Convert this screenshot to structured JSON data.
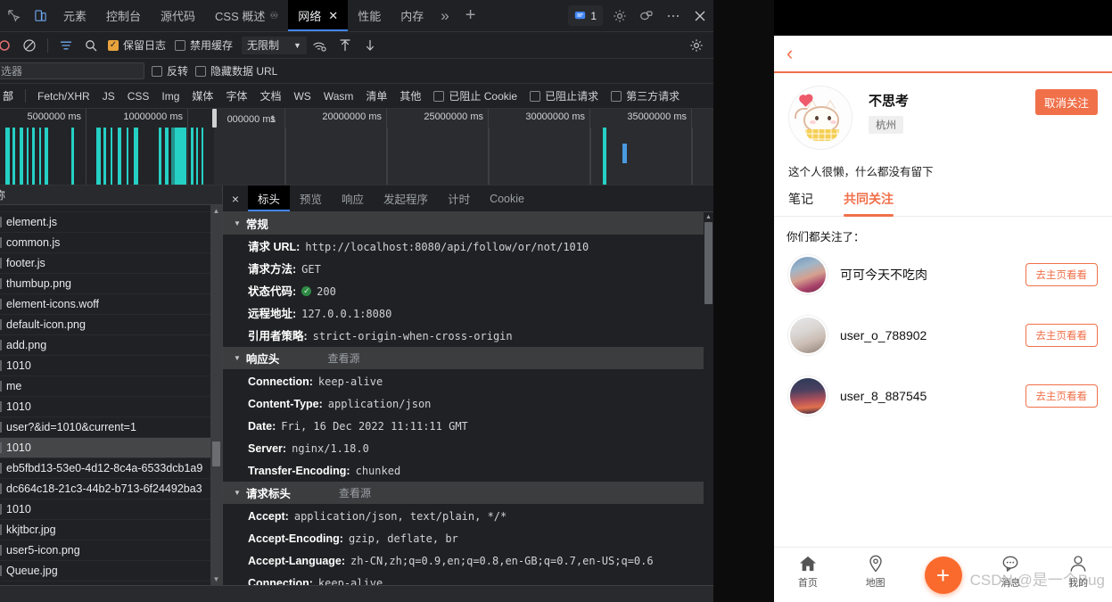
{
  "devtools": {
    "tabs": [
      {
        "label": "元素",
        "selected": false
      },
      {
        "label": "控制台",
        "selected": false
      },
      {
        "label": "源代码",
        "selected": false
      },
      {
        "label": "CSS 概述",
        "selected": false,
        "warn": true
      },
      {
        "label": "网络",
        "selected": true,
        "closable": true
      },
      {
        "label": "性能",
        "selected": false
      },
      {
        "label": "内存",
        "selected": false
      }
    ],
    "overflow_label": "»",
    "add_label": "+",
    "issues_count": "1",
    "icons": {
      "inspect": "inspect-icon",
      "device": "device-toolbar-icon",
      "settings": "gear-icon",
      "feedback": "feedback-icon",
      "more": "more-options-icon",
      "close": "close-icon"
    },
    "toolbar": {
      "record_title": "record-button",
      "clear_title": "clear-button",
      "filter_title": "filter-button",
      "search_title": "search-button",
      "preserve_log": {
        "label": "保留日志",
        "checked": true
      },
      "disable_cache": {
        "label": "禁用缓存",
        "checked": false
      },
      "throttle": {
        "value": "无限制",
        "caret": "▼"
      },
      "wifi_title": "network-conditions-icon",
      "import_title": "import-har-icon",
      "export_title": "export-har-icon",
      "settings_title": "network-settings-gear-icon"
    },
    "filter_row": {
      "input_placeholder": "选器",
      "invert": {
        "label": "反转",
        "checked": false
      },
      "hide_data_urls": {
        "label": "隐藏数据 URL",
        "checked": false
      }
    },
    "type_row": {
      "items": [
        "部",
        "Fetch/XHR",
        "JS",
        "CSS",
        "Img",
        "媒体",
        "字体",
        "文档",
        "WS",
        "Wasm",
        "清单",
        "其他"
      ],
      "selected_index": 0,
      "checks": [
        {
          "label": "已阻止 Cookie",
          "checked": false
        },
        {
          "label": "已阻止请求",
          "checked": false
        },
        {
          "label": "第三方请求",
          "checked": false
        }
      ]
    },
    "overview": {
      "ticks": [
        "5000000 ms",
        "10000000 ms",
        "000000 ms",
        "20000000 ms",
        "25000000 ms",
        "30000000 ms",
        "35000000 ms"
      ],
      "partial_tick_prefix": "1"
    },
    "requests": {
      "column_header": "称",
      "rows": [
        {
          "name": "element.js",
          "selected": false
        },
        {
          "name": "common.js",
          "selected": false
        },
        {
          "name": "footer.js",
          "selected": false
        },
        {
          "name": "thumbup.png",
          "selected": false
        },
        {
          "name": "element-icons.woff",
          "selected": false
        },
        {
          "name": "default-icon.png",
          "selected": false
        },
        {
          "name": "add.png",
          "selected": false
        },
        {
          "name": "1010",
          "selected": false
        },
        {
          "name": "me",
          "selected": false
        },
        {
          "name": "1010",
          "selected": false
        },
        {
          "name": "user?&id=1010&current=1",
          "selected": false
        },
        {
          "name": "1010",
          "selected": true
        },
        {
          "name": "eb5fbd13-53e0-4d12-8c4a-6533dcb1a9",
          "selected": false
        },
        {
          "name": "dc664c18-21c3-44b2-b713-6f24492ba3",
          "selected": false
        },
        {
          "name": "1010",
          "selected": false
        },
        {
          "name": "kkjtbcr.jpg",
          "selected": false
        },
        {
          "name": "user5-icon.png",
          "selected": false
        },
        {
          "name": "Queue.jpg",
          "selected": false
        }
      ]
    },
    "detail": {
      "close_label": "×",
      "tabs": [
        {
          "label": "标头",
          "selected": true
        },
        {
          "label": "预览",
          "selected": false
        },
        {
          "label": "响应",
          "selected": false
        },
        {
          "label": "发起程序",
          "selected": false
        },
        {
          "label": "计时",
          "selected": false
        },
        {
          "label": "Cookie",
          "selected": false
        }
      ],
      "view_source_label": "查看源",
      "sections": [
        {
          "title": "常规",
          "has_source_link": false,
          "rows": [
            {
              "key": "请求 URL:",
              "value": "http://localhost:8080/api/follow/or/not/1010"
            },
            {
              "key": "请求方法:",
              "value": "GET"
            },
            {
              "key": "状态代码:",
              "value": "200",
              "status_ok": true
            },
            {
              "key": "远程地址:",
              "value": "127.0.0.1:8080"
            },
            {
              "key": "引用者策略:",
              "value": "strict-origin-when-cross-origin"
            }
          ]
        },
        {
          "title": "响应头",
          "has_source_link": true,
          "rows": [
            {
              "key": "Connection:",
              "value": "keep-alive"
            },
            {
              "key": "Content-Type:",
              "value": "application/json"
            },
            {
              "key": "Date:",
              "value": "Fri, 16 Dec 2022 11:11:11 GMT"
            },
            {
              "key": "Server:",
              "value": "nginx/1.18.0"
            },
            {
              "key": "Transfer-Encoding:",
              "value": "chunked"
            }
          ]
        },
        {
          "title": "请求标头",
          "has_source_link": true,
          "rows": [
            {
              "key": "Accept:",
              "value": "application/json, text/plain, */*"
            },
            {
              "key": "Accept-Encoding:",
              "value": "gzip, deflate, br"
            },
            {
              "key": "Accept-Language:",
              "value": "zh-CN,zh;q=0.9,en;q=0.8,en-GB;q=0.7,en-US;q=0.6"
            },
            {
              "key": "Connection:",
              "value": "keep-alive"
            }
          ]
        }
      ]
    }
  },
  "phone": {
    "back_label": "‹",
    "profile": {
      "name": "不思考",
      "city": "杭州",
      "unfollow_label": "取消关注",
      "bio": "这个人很懒，什么都没有留下",
      "avatar_name": "cat-avatar"
    },
    "tabs": [
      {
        "label": "笔记",
        "selected": false
      },
      {
        "label": "共同关注",
        "selected": true
      }
    ],
    "list_label": "你们都关注了：",
    "users": [
      {
        "name": "可可今天不吃肉",
        "button": "去主页看看"
      },
      {
        "name": "user_o_788902",
        "button": "去主页看看"
      },
      {
        "name": "user_8_887545",
        "button": "去主页看看"
      }
    ],
    "bottom_nav": [
      {
        "label": "首页",
        "icon": "home-icon"
      },
      {
        "label": "地图",
        "icon": "map-pin-icon"
      },
      {
        "label": "消息",
        "icon": "message-icon"
      },
      {
        "label": "我的",
        "icon": "profile-icon"
      }
    ],
    "fab_label": "+",
    "watermark": "CSDN @是一个Bug"
  }
}
